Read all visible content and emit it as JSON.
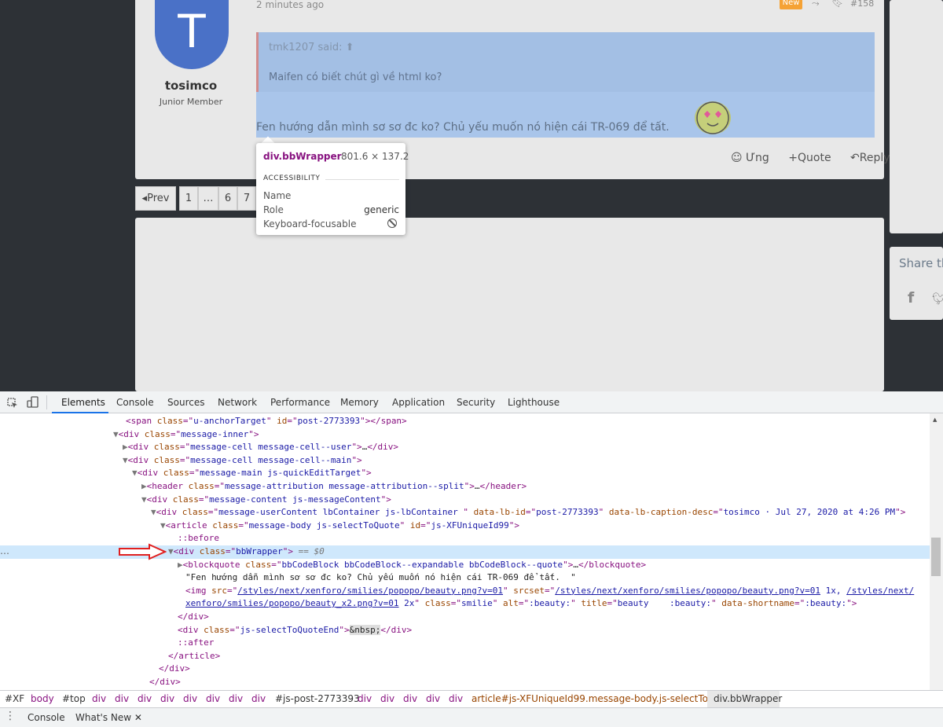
{
  "forum": {
    "time_ago": "2 minutes ago",
    "new_badge": "New",
    "post_number": "#158",
    "user": {
      "avatar_letter": "T",
      "name": "tosimco",
      "title": "Junior Member",
      "avatar_color": "#4a71c7"
    },
    "quote": {
      "author": "tmk1207 said:",
      "text": "Maifen có biết chút gì về html ko?"
    },
    "post_text": "Fen hướng dẫn mình sơ sơ đc ko? Chủ yếu muốn nó hiện cái TR-069 để tất.",
    "actions": {
      "ung": "Ưng",
      "quote": "Quote",
      "reply": "Reply"
    },
    "pager": [
      "Prev",
      "1",
      "…",
      "6",
      "7"
    ],
    "share_title": "Share th"
  },
  "tooltip": {
    "element": "div.bbWrapper",
    "size": "801.6 × 137.2",
    "heading": "ACCESSIBILITY",
    "rows": [
      {
        "label": "Name",
        "value": ""
      },
      {
        "label": "Role",
        "value": "generic"
      },
      {
        "label": "Keyboard-focusable",
        "value": ""
      }
    ]
  },
  "devtools": {
    "tabs": [
      "Elements",
      "Console",
      "Sources",
      "Network",
      "Performance",
      "Memory",
      "Application",
      "Security",
      "Lighthouse"
    ],
    "active_tab": "Elements",
    "breadcrumbs": [
      "#XF",
      "body",
      "#top",
      "div",
      "div",
      "div",
      "div",
      "div",
      "div",
      "div",
      "div",
      "#js-post-2773393",
      "div",
      "div",
      "div",
      "div",
      "div",
      "article#js-XFUniqueId99.message-body.js-selectToQuote",
      "div.bbWrapper"
    ],
    "drawer_tabs": [
      "Console",
      "What's New"
    ],
    "selected_marker": "== $0",
    "ellipsis": "…"
  }
}
